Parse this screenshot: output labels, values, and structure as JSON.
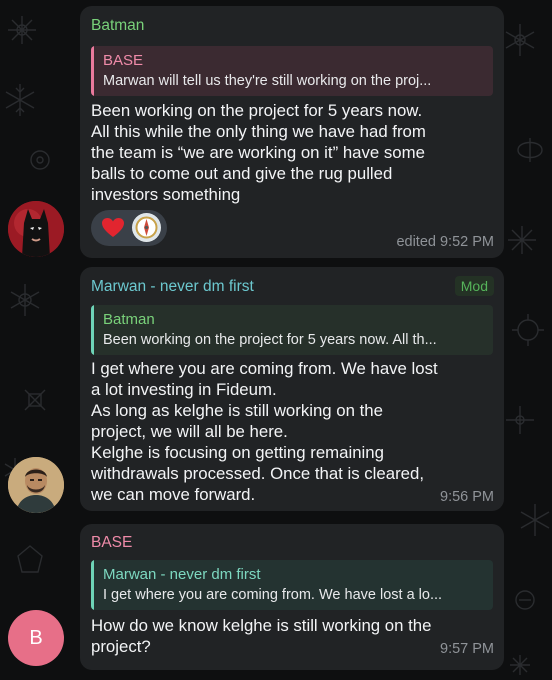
{
  "messages": [
    {
      "sender": "Batman",
      "sender_color": "#79d17a",
      "reply": {
        "name": "BASE",
        "text": "Marwan will tell us they're still working on the proj..."
      },
      "lines": [
        "Been working on the project for 5 years now.",
        "All this while the only thing we have had from",
        "the team is “we are working on it” have some",
        "balls to come out and give the rug pulled",
        "investors something"
      ],
      "reactions": [
        "heart-icon",
        "compass-icon"
      ],
      "time": "edited 9:52 PM",
      "avatar": "batman-avatar"
    },
    {
      "sender": "Marwan - never dm first",
      "sender_color": "#6cc8cf",
      "badge": "Mod",
      "reply": {
        "name": "Batman",
        "text": "Been working on the project for 5 years now. All th..."
      },
      "lines": [
        "I get where you are coming from. We have lost",
        "a lot investing in Fideum.",
        "As long as kelghe is still working on the",
        "project, we will all be here.",
        "Kelghe is focusing on getting remaining",
        "withdrawals processed. Once that is cleared,",
        "we can move forward."
      ],
      "time": "9:56 PM",
      "avatar": "marwan-avatar"
    },
    {
      "sender": "BASE",
      "sender_color": "#ef8ba9",
      "reply": {
        "name": "Marwan - never dm first",
        "text": "I get where you are coming from. We have lost a lo..."
      },
      "lines": [
        "How do we know kelghe is still working on the",
        "project?"
      ],
      "time": "9:57 PM",
      "avatar_letter": "B"
    }
  ]
}
